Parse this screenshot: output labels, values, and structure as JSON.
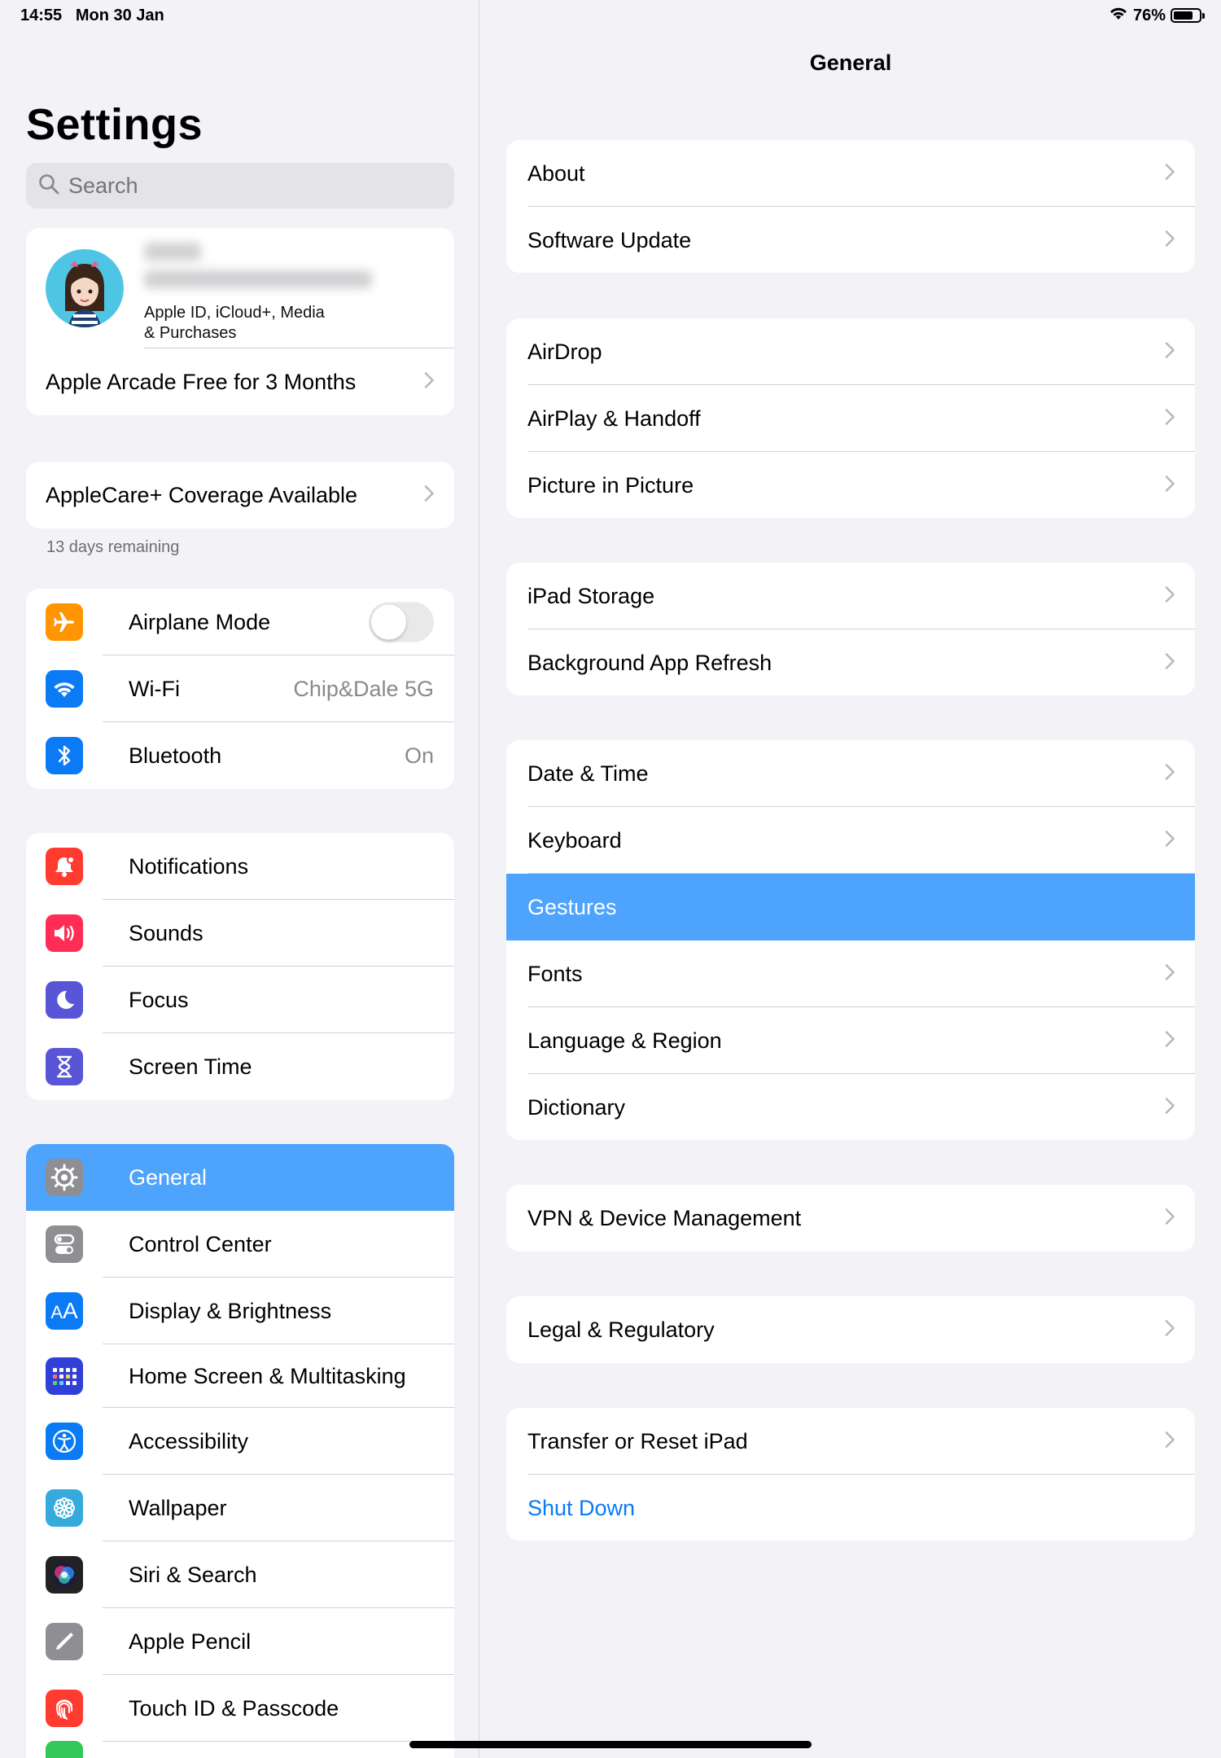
{
  "status": {
    "time": "14:55",
    "date": "Mon 30 Jan",
    "battery": "76%",
    "battery_level": 0.76
  },
  "sidebar": {
    "title": "Settings",
    "search_placeholder": "Search",
    "profile": {
      "subtitle_line1": "Apple ID, iCloud+, Media",
      "subtitle_line2": "& Purchases",
      "offer": "Apple Arcade Free for 3 Months"
    },
    "applecare": {
      "label": "AppleCare+ Coverage Available",
      "caption": "13 days remaining"
    },
    "connectivity": [
      {
        "label": "Airplane Mode",
        "icon": "airplane-icon",
        "color": "#ff9500",
        "toggle": false
      },
      {
        "label": "Wi-Fi",
        "icon": "wifi-icon",
        "color": "#0a7af5",
        "value": "Chip&Dale 5G"
      },
      {
        "label": "Bluetooth",
        "icon": "bluetooth-icon",
        "color": "#0a7af5",
        "value": "On"
      }
    ],
    "notifications": [
      {
        "label": "Notifications",
        "icon": "bell-icon",
        "color": "#ff3b30"
      },
      {
        "label": "Sounds",
        "icon": "speaker-icon",
        "color": "#ff2d55"
      },
      {
        "label": "Focus",
        "icon": "moon-icon",
        "color": "#5856d6"
      },
      {
        "label": "Screen Time",
        "icon": "hourglass-icon",
        "color": "#5856d6"
      }
    ],
    "general": [
      {
        "label": "General",
        "icon": "gear-icon",
        "color": "#8e8e93",
        "selected": true
      },
      {
        "label": "Control Center",
        "icon": "switches-icon",
        "color": "#8e8e93"
      },
      {
        "label": "Display & Brightness",
        "icon": "text-size-icon",
        "color": "#0a7af5"
      },
      {
        "label": "Home Screen & Multitasking",
        "icon": "grid-icon",
        "color": "#2f3fd8"
      },
      {
        "label": "Accessibility",
        "icon": "accessibility-icon",
        "color": "#0a7af5"
      },
      {
        "label": "Wallpaper",
        "icon": "flower-icon",
        "color": "#35aadc"
      },
      {
        "label": "Siri & Search",
        "icon": "siri-icon",
        "color": "#222222"
      },
      {
        "label": "Apple Pencil",
        "icon": "pencil-icon",
        "color": "#8e8e93"
      },
      {
        "label": "Touch ID & Passcode",
        "icon": "fingerprint-icon",
        "color": "#ff3b30"
      }
    ]
  },
  "detail": {
    "title": "General",
    "groups": [
      [
        {
          "label": "About"
        },
        {
          "label": "Software Update"
        }
      ],
      [
        {
          "label": "AirDrop"
        },
        {
          "label": "AirPlay & Handoff"
        },
        {
          "label": "Picture in Picture"
        }
      ],
      [
        {
          "label": "iPad Storage"
        },
        {
          "label": "Background App Refresh"
        }
      ],
      [
        {
          "label": "Date & Time"
        },
        {
          "label": "Keyboard"
        },
        {
          "label": "Gestures",
          "selected": true
        },
        {
          "label": "Fonts"
        },
        {
          "label": "Language & Region"
        },
        {
          "label": "Dictionary"
        }
      ],
      [
        {
          "label": "VPN & Device Management"
        }
      ],
      [
        {
          "label": "Legal & Regulatory"
        }
      ],
      [
        {
          "label": "Transfer or Reset iPad"
        },
        {
          "label": "Shut Down",
          "link": true
        }
      ]
    ]
  }
}
